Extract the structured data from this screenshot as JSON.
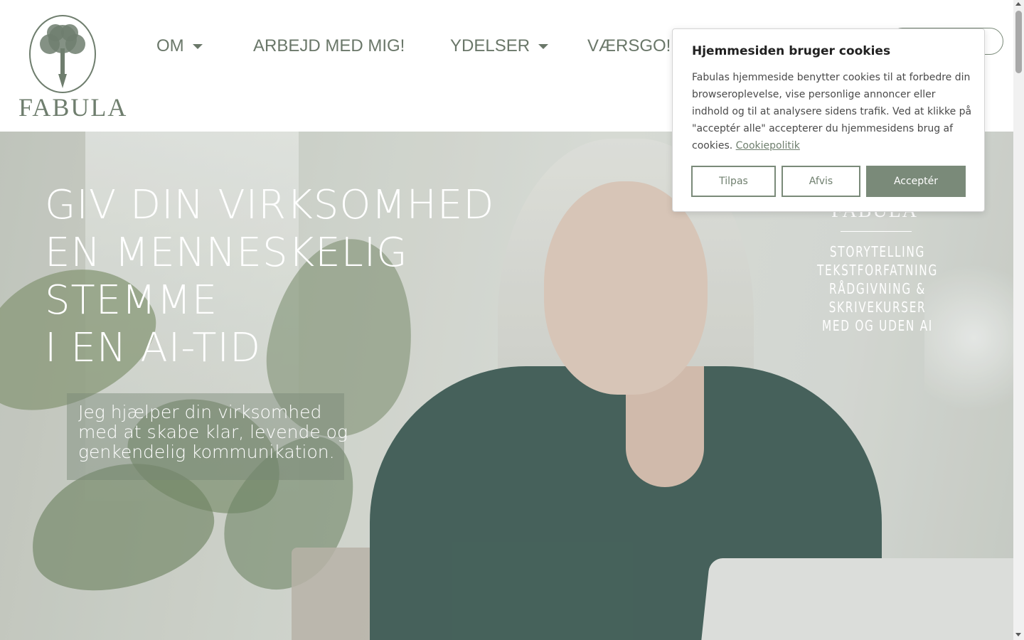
{
  "brand": {
    "logo_text": "FABULA"
  },
  "nav": {
    "items": [
      {
        "label": "OM",
        "has_dropdown": true
      },
      {
        "label": "ARBEJD MED MIG!",
        "has_dropdown": false
      },
      {
        "label": "YDELSER",
        "has_dropdown": true
      },
      {
        "label": "VÆRSGO!",
        "has_dropdown": true
      }
    ]
  },
  "hero": {
    "title_lines": [
      "GIV DIN VIRKSOMHED",
      "EN MENNESKELIG",
      "STEMME",
      "I EN AI-TID"
    ],
    "subtitle_lines": [
      "Jeg hjælper din virksomhed",
      "med at skabe klar, levende og",
      "genkendelig kommunikation."
    ],
    "brand_word": "FABULA",
    "services": [
      "STORYTELLING",
      "TEKSTFORFATNING",
      "RÅDGIVNING &",
      "SKRIVEKURSER",
      "MED OG UDEN AI"
    ]
  },
  "cookie": {
    "title": "Hjemmesiden bruger cookies",
    "text": "Fabulas hjemmeside benytter cookies til at forbedre din browseroplevelse, vise personlige annoncer eller indhold og til at analysere sidens trafik. Ved at klikke på \"acceptér alle\" accepterer du hjemmesidens brug af cookies.",
    "link": "Cookiepolitik",
    "buttons": {
      "customize": "Tilpas",
      "reject": "Afvis",
      "accept": "Acceptér"
    }
  },
  "colors": {
    "accent": "#7a8a79",
    "nav_text": "#6a7769"
  }
}
